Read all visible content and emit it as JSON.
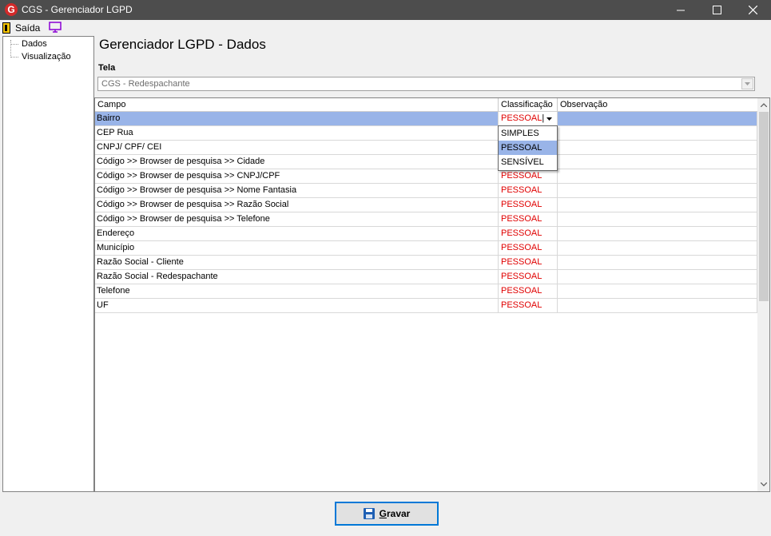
{
  "window": {
    "title": "CGS - Gerenciador LGPD",
    "app_icon_letter": "G"
  },
  "menu": {
    "saida_label": "Saída"
  },
  "tree": {
    "items": [
      "Dados",
      "Visualização"
    ]
  },
  "main": {
    "page_title": "Gerenciador LGPD - Dados",
    "tela_label": "Tela",
    "tela_value": "CGS - Redespachante"
  },
  "grid": {
    "columns": [
      "Campo",
      "Classificação",
      "Observação"
    ],
    "rows": [
      {
        "campo": "Bairro",
        "classificacao": "PESSOAL",
        "observacao": ""
      },
      {
        "campo": "CEP Rua",
        "classificacao": "",
        "observacao": ""
      },
      {
        "campo": "CNPJ/ CPF/ CEI",
        "classificacao": "",
        "observacao": ""
      },
      {
        "campo": "Código >> Browser de pesquisa >> Cidade",
        "classificacao": "",
        "observacao": ""
      },
      {
        "campo": "Código >> Browser de pesquisa >> CNPJ/CPF",
        "classificacao": "PESSOAL",
        "observacao": ""
      },
      {
        "campo": "Código >> Browser de pesquisa >> Nome Fantasia",
        "classificacao": "PESSOAL",
        "observacao": ""
      },
      {
        "campo": "Código >> Browser de pesquisa >> Razão Social",
        "classificacao": "PESSOAL",
        "observacao": ""
      },
      {
        "campo": "Código >> Browser de pesquisa >> Telefone",
        "classificacao": "PESSOAL",
        "observacao": ""
      },
      {
        "campo": "Endereço",
        "classificacao": "PESSOAL",
        "observacao": ""
      },
      {
        "campo": "Município",
        "classificacao": "PESSOAL",
        "observacao": ""
      },
      {
        "campo": "Razão Social - Cliente",
        "classificacao": "PESSOAL",
        "observacao": ""
      },
      {
        "campo": "Razão Social - Redespachante",
        "classificacao": "PESSOAL",
        "observacao": ""
      },
      {
        "campo": "Telefone",
        "classificacao": "PESSOAL",
        "observacao": ""
      },
      {
        "campo": "UF",
        "classificacao": "PESSOAL",
        "observacao": ""
      }
    ],
    "selected_row": 0,
    "dropdown_options": [
      "SIMPLES",
      "PESSOAL",
      "SENSÍVEL"
    ],
    "dropdown_highlighted": 1
  },
  "footer": {
    "gravar_label": "Gravar"
  },
  "colors": {
    "titlebar": "#4d4d4d",
    "selection": "#99b4e8",
    "classification_text": "#e00000",
    "button_border": "#0078d7"
  }
}
